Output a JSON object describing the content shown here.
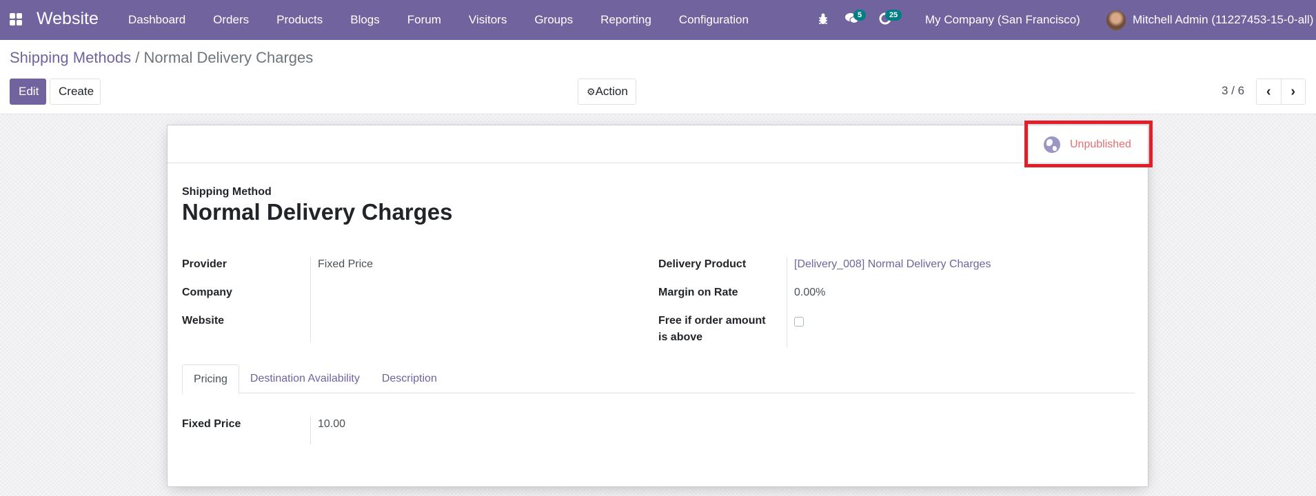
{
  "navbar": {
    "app_name": "Website",
    "menu": [
      "Dashboard",
      "Orders",
      "Products",
      "Blogs",
      "Forum",
      "Visitors",
      "Groups",
      "Reporting",
      "Configuration"
    ],
    "messages_count": "5",
    "activities_count": "25",
    "company": "My Company (San Francisco)",
    "user": "Mitchell Admin (11227453-15-0-all)"
  },
  "breadcrumb": {
    "parent": "Shipping Methods",
    "separator": "/",
    "current": "Normal Delivery Charges"
  },
  "toolbar": {
    "edit_label": "Edit",
    "create_label": "Create",
    "action_label": "Action",
    "pager_value": "3 / 6"
  },
  "record": {
    "publish_status": "Unpublished",
    "title_label": "Shipping Method",
    "title": "Normal Delivery Charges",
    "left_fields": [
      {
        "label": "Provider",
        "value": "Fixed Price"
      },
      {
        "label": "Company",
        "value": ""
      },
      {
        "label": "Website",
        "value": ""
      }
    ],
    "right_fields": [
      {
        "label": "Delivery Product",
        "value": "[Delivery_008] Normal Delivery Charges"
      },
      {
        "label": "Margin on Rate",
        "value": "0.00%"
      },
      {
        "label": "Free if order amount is above",
        "value": false
      }
    ],
    "tabs": [
      "Pricing",
      "Destination Availability",
      "Description"
    ],
    "active_tab": "Pricing",
    "pricing": {
      "label": "Fixed Price",
      "value": "10.00"
    }
  },
  "colors": {
    "brand": "#71639e",
    "badge": "#017e84",
    "unpublished": "#e46f6f",
    "highlight": "#e41e26"
  }
}
